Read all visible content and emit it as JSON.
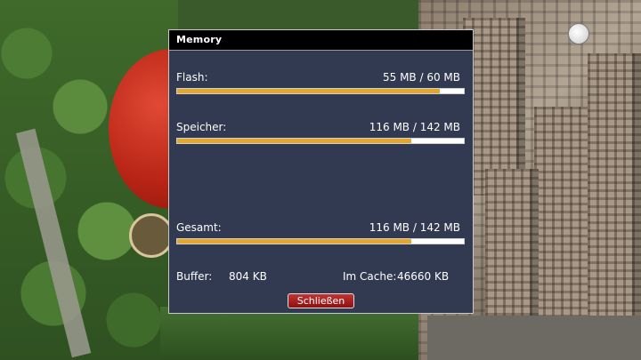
{
  "dialog": {
    "title": "Memory",
    "rows": [
      {
        "label": "Flash:",
        "value": "55 MB / 60 MB",
        "fill_fraction": 0.917
      },
      {
        "label": "Speicher:",
        "value": "116 MB / 142 MB",
        "fill_fraction": 0.817
      },
      {
        "label": "Gesamt:",
        "value": "116 MB / 142 MB",
        "fill_fraction": 0.817
      }
    ],
    "buffer_label": "Buffer:",
    "buffer_value": "804 KB",
    "cache_label": "Im Cache:",
    "cache_value": "46660 KB",
    "close_label": "Schließen"
  },
  "colors": {
    "dialog_background": "#323a52",
    "bar_fill": "#e3a72f",
    "close_button": "#b02020"
  },
  "icons": [
    "channel-logo-icon"
  ]
}
